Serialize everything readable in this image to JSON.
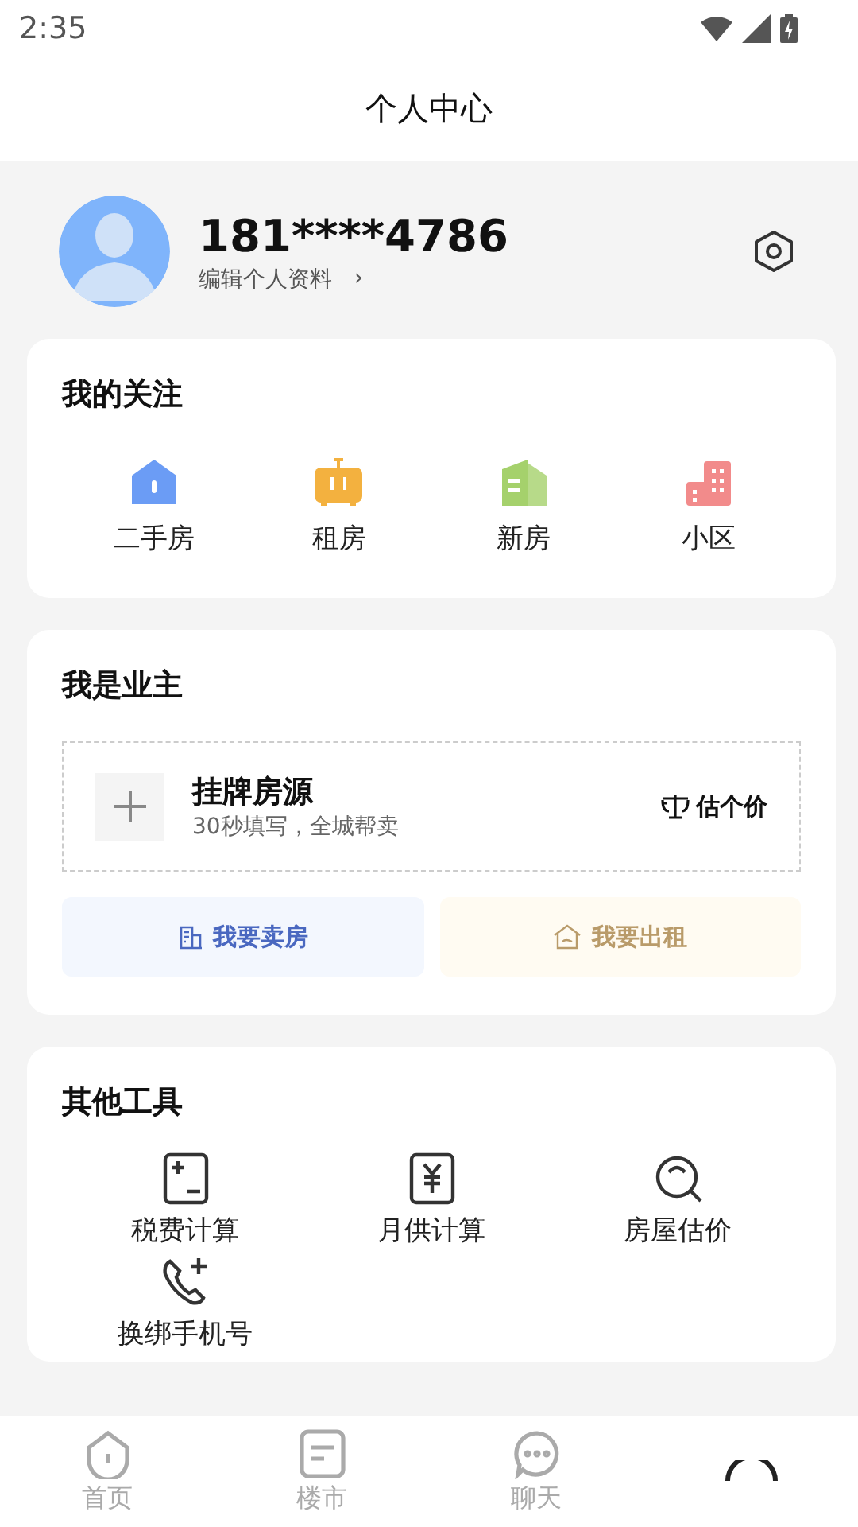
{
  "status_bar": {
    "time": "2:35"
  },
  "header": {
    "title": "个人中心"
  },
  "profile": {
    "phone": "181****4786",
    "edit_link": "编辑个人资料",
    "edit_arrow": "›"
  },
  "follows": {
    "title": "我的关注",
    "items": [
      {
        "label": "二手房",
        "color": "#6b9cf5"
      },
      {
        "label": "租房",
        "color": "#f3b13f"
      },
      {
        "label": "新房",
        "color": "#a5d16c"
      },
      {
        "label": "小区",
        "color": "#f28b8b"
      }
    ]
  },
  "owner": {
    "title": "我是业主",
    "listing": {
      "title": "挂牌房源",
      "subtitle": "30秒填写，全城帮卖",
      "action": "估个价"
    },
    "buttons": [
      {
        "label": "我要卖房",
        "kind": "sell"
      },
      {
        "label": "我要出租",
        "kind": "rent"
      }
    ]
  },
  "tools": {
    "title": "其他工具",
    "items": [
      {
        "label": "税费计算"
      },
      {
        "label": "月供计算"
      },
      {
        "label": "房屋估价"
      },
      {
        "label": "换绑手机号"
      }
    ]
  },
  "tab_bar": {
    "tabs": [
      {
        "label": "首页",
        "selected": false
      },
      {
        "label": "楼市",
        "selected": false
      },
      {
        "label": "聊天",
        "selected": false
      }
    ]
  }
}
